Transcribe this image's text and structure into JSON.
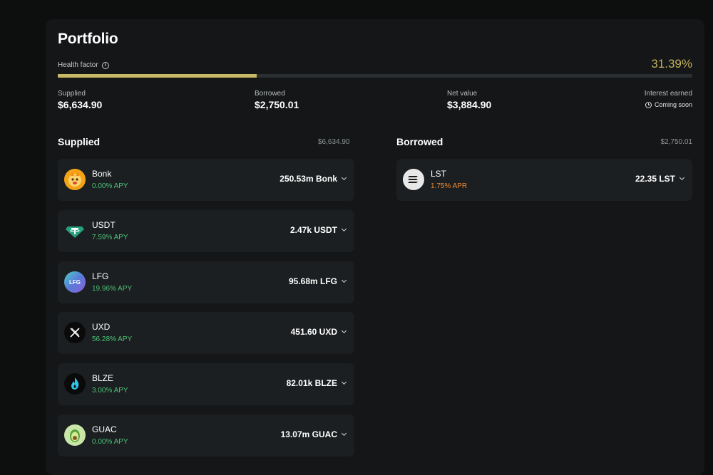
{
  "portfolio": {
    "title": "Portfolio",
    "health_factor": {
      "label": "Health factor",
      "value": "31.39%",
      "fraction": 0.3139,
      "color": "#c9b966"
    },
    "stats": {
      "supplied": {
        "label": "Supplied",
        "value": "$6,634.90"
      },
      "borrowed": {
        "label": "Borrowed",
        "value": "$2,750.01"
      },
      "net_value": {
        "label": "Net value",
        "value": "$3,884.90"
      },
      "interest_earned": {
        "label": "Interest earned",
        "value": "Coming soon",
        "icon": "clock-icon"
      }
    }
  },
  "supplied": {
    "heading": "Supplied",
    "total": "$6,634.90",
    "items": [
      {
        "name": "Bonk",
        "rate": "0.00% APY",
        "amount": "250.53m Bonk",
        "icon": "bonk-icon"
      },
      {
        "name": "USDT",
        "rate": "7.59% APY",
        "amount": "2.47k USDT",
        "icon": "usdt-icon"
      },
      {
        "name": "LFG",
        "rate": "19.96% APY",
        "amount": "95.68m LFG",
        "icon": "lfg-icon"
      },
      {
        "name": "UXD",
        "rate": "56.28% APY",
        "amount": "451.60 UXD",
        "icon": "uxd-icon"
      },
      {
        "name": "BLZE",
        "rate": "3.00% APY",
        "amount": "82.01k BLZE",
        "icon": "blze-icon"
      },
      {
        "name": "GUAC",
        "rate": "0.00% APY",
        "amount": "13.07m GUAC",
        "icon": "guac-icon"
      }
    ]
  },
  "borrowed": {
    "heading": "Borrowed",
    "total": "$2,750.01",
    "items": [
      {
        "name": "LST",
        "rate": "1.75% APR",
        "amount": "22.35 LST",
        "icon": "lst-icon"
      }
    ]
  },
  "colors": {
    "accent": "#c9b966",
    "apy_green": "#4cc178",
    "apr_orange": "#f28a2e",
    "card_bg": "#1c1f21",
    "panel_bg": "#141617"
  }
}
